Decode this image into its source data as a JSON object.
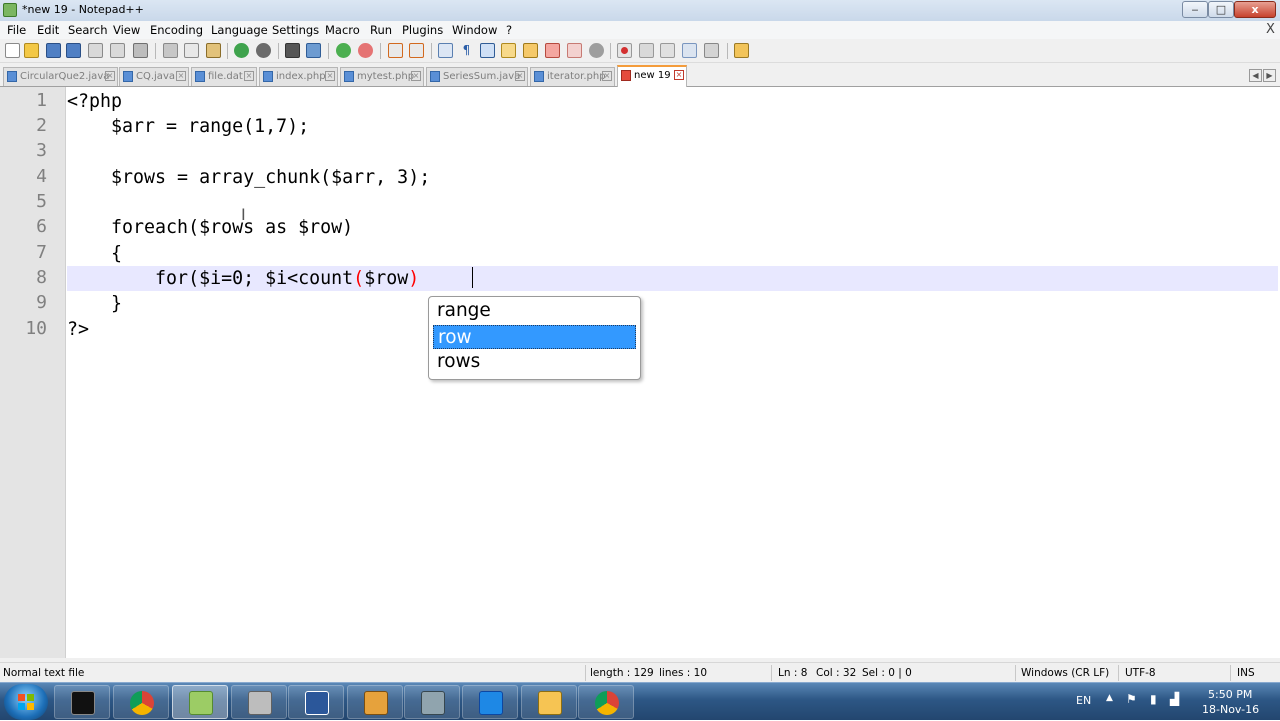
{
  "window": {
    "title": "*new 19 - Notepad++",
    "minimize_glyph": "‒",
    "maximize_glyph": "□",
    "close_glyph": "x"
  },
  "menu": {
    "items": [
      "File",
      "Edit",
      "Search",
      "View",
      "Encoding",
      "Language",
      "Settings",
      "Macro",
      "Run",
      "Plugins",
      "Window",
      "?"
    ],
    "close_glyph": "X"
  },
  "tabs": [
    {
      "label": "CircularQue2.java",
      "active": false
    },
    {
      "label": "CQ.java",
      "active": false
    },
    {
      "label": "file.dat",
      "active": false
    },
    {
      "label": "index.php",
      "active": false
    },
    {
      "label": "mytest.php",
      "active": false
    },
    {
      "label": "SeriesSum.java",
      "active": false
    },
    {
      "label": "iterator.php",
      "active": false
    },
    {
      "label": "new 19",
      "active": true
    }
  ],
  "editor": {
    "line_numbers": [
      "1",
      "2",
      "3",
      "4",
      "5",
      "6",
      "7",
      "8",
      "9",
      "10"
    ],
    "lines": [
      "<?php",
      "    $arr = range(1,7);",
      "",
      "    $rows = array_chunk($arr, 3);",
      "",
      "    foreach($rows as $row)",
      "    {",
      "        for($i=0; $i<count",
      "    }",
      "?>"
    ],
    "line8_paren_open": "(",
    "line8_arg": "$row",
    "line8_paren_close": ")",
    "current_line": 8
  },
  "autocomplete": {
    "items": [
      "range",
      "row",
      "rows"
    ],
    "selected": "row"
  },
  "status": {
    "file_type": "Normal text file",
    "length": "length : 129",
    "lines": "lines : 10",
    "ln": "Ln : 8",
    "col": "Col : 32",
    "sel": "Sel : 0 | 0",
    "eol": "Windows (CR LF)",
    "encoding": "UTF-8",
    "mode": "INS"
  },
  "taskbar": {
    "apps": [
      "cmd-icon",
      "chrome-icon",
      "notepadpp-icon",
      "printer-icon",
      "word-icon",
      "game-icon",
      "calculator-icon",
      "virtualbox-icon",
      "explorer-icon",
      "chrome-icon-2"
    ],
    "tray": {
      "language": "EN",
      "time": "5:50 PM",
      "date": "18-Nov-16"
    }
  }
}
